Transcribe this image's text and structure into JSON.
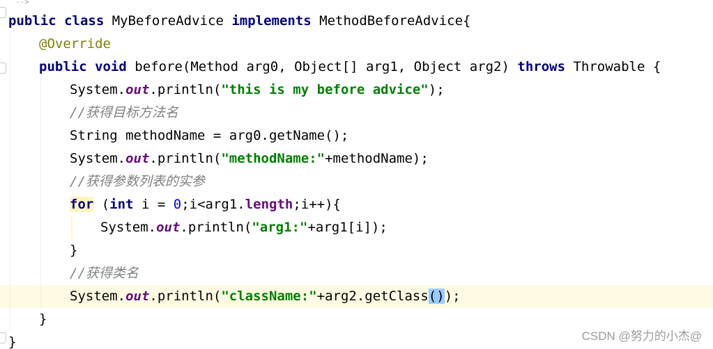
{
  "editor": {
    "top_fragment": "-->",
    "code": {
      "class_decl": [
        "public",
        " ",
        "class",
        " MyBeforeAdvice ",
        "implements",
        " MethodBeforeAdvice{"
      ],
      "annotation": "@Override",
      "method_decl": [
        "public",
        " ",
        "void",
        " before(Method arg0, Object[] arg1, Object arg2) ",
        "throws",
        " Throwable {"
      ],
      "line4": [
        "System.",
        "out",
        ".println(",
        "\"this is my before advice\"",
        ");"
      ],
      "comment1": "//获得目标方法名",
      "line6": "String methodName = arg0.getName();",
      "line7": [
        "System.",
        "out",
        ".println(",
        "\"methodName:\"",
        "+methodName);"
      ],
      "comment2": "//获得参数列表的实参",
      "line9": [
        "for",
        " (",
        "int",
        " i = ",
        "0",
        ";i<arg1.",
        "length",
        ";i++){"
      ],
      "line10": [
        "System.",
        "out",
        ".println(",
        "\"arg1:\"",
        "+arg1[i]);"
      ],
      "close_for": "}",
      "comment3": "//获得类名",
      "line13": [
        "System.",
        "out",
        ".println(",
        "\"className:\"",
        "+arg2.getClass",
        "()",
        ");"
      ],
      "close_method": "}",
      "close_class": "}"
    },
    "colors": {
      "keyword": "#000080",
      "string": "#008000",
      "field": "#660e7a",
      "annotation": "#808000",
      "comment": "#808080",
      "number": "#0000ff",
      "current_line": "#fffae3",
      "paren_match": "#99ccff"
    }
  },
  "watermark": "CSDN @努力的小杰@"
}
